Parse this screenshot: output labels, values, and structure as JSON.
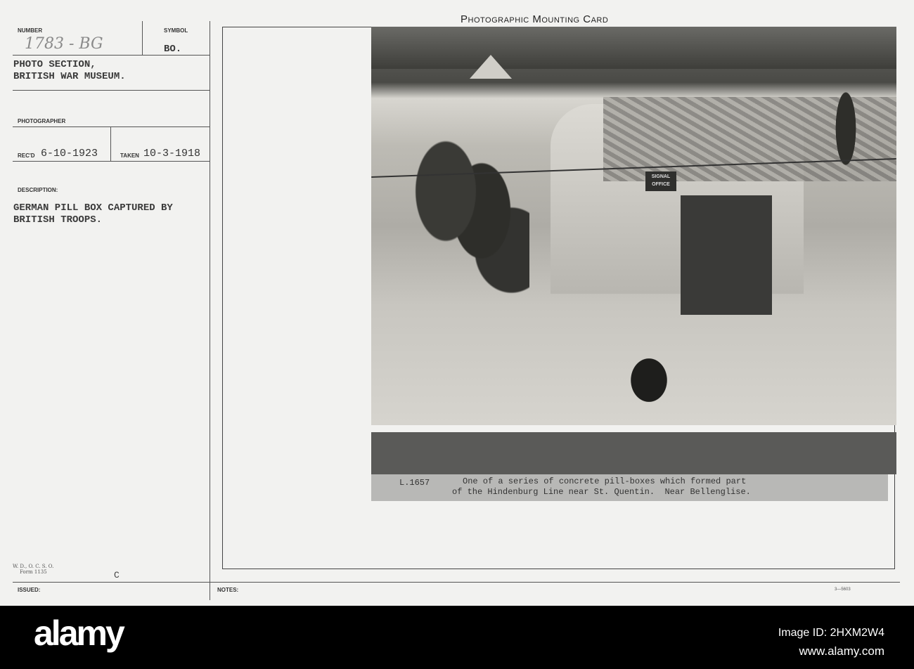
{
  "card_title": "Photographic Mounting Card",
  "number": {
    "label": "NUMBER",
    "value": "1783 - BG"
  },
  "symbol": {
    "label": "SYMBOL",
    "value": "BO."
  },
  "section": [
    "PHOTO SECTION,",
    "BRITISH WAR MUSEUM."
  ],
  "photographer": {
    "label": "PHOTOGRAPHER"
  },
  "received": {
    "label": "REC'D",
    "value": "6-10-1923"
  },
  "taken": {
    "label": "TAKEN",
    "value": "10-3-1918"
  },
  "description": {
    "label": "DESCRIPTION:",
    "lines": [
      "GERMAN PILL BOX CAPTURED BY",
      "BRITISH TROOPS."
    ]
  },
  "form": {
    "line1": "W. D., O. C. S. O.",
    "line2": "Form 1135",
    "mark": "C"
  },
  "issued_label": "ISSUED:",
  "notes_label": "NOTES:",
  "print_code": "3—5603",
  "photo": {
    "sign": "SIGNAL OFFICE",
    "caption_id": "L.1657",
    "caption_lines": [
      "One of a series of concrete pill-boxes which formed part",
      "of the Hindenburg Line near St. Quentin.  Near Bellenglise."
    ]
  },
  "footer": {
    "logo": "alamy",
    "image_id": "Image ID: 2HXM2W4",
    "url": "www.alamy.com"
  }
}
